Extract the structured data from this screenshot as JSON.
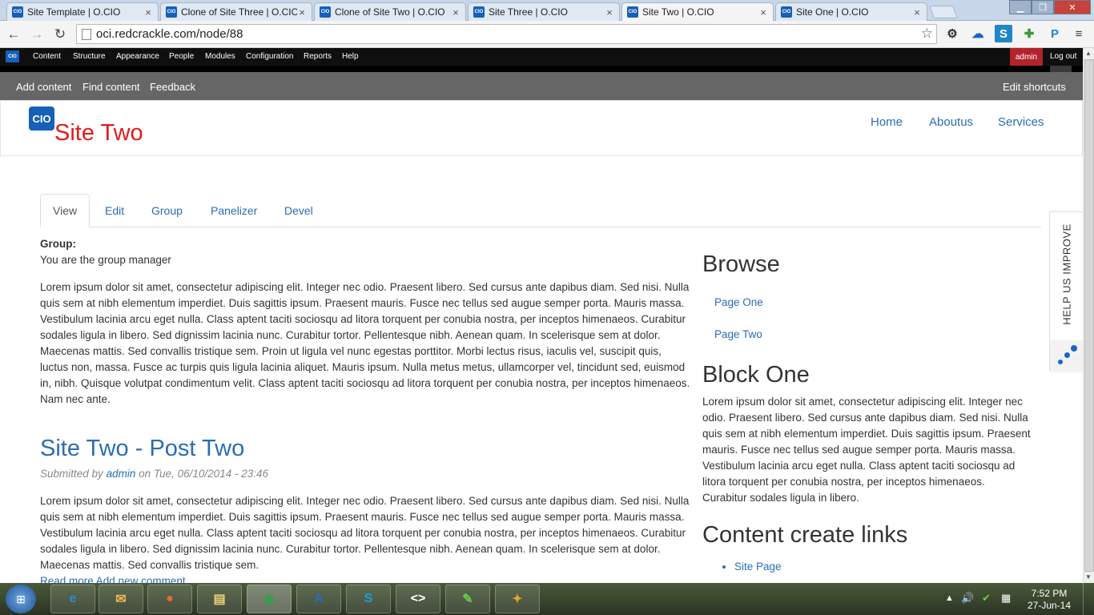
{
  "browser": {
    "tabs": [
      {
        "title": "Site Template | O.CIO",
        "favicon": "CIO"
      },
      {
        "title": "Clone of Site Three | O.CIO",
        "favicon": "CIO"
      },
      {
        "title": "Clone of Site Two | O.CIO",
        "favicon": "CIO"
      },
      {
        "title": "Site Three | O.CIO",
        "favicon": "CIO"
      },
      {
        "title": "Site Two | O.CIO",
        "favicon": "CIO",
        "active": true
      },
      {
        "title": "Site One | O.CIO",
        "favicon": "CIO"
      }
    ],
    "url": "oci.redcrackle.com/node/88"
  },
  "admin_menu": {
    "logo": "CIO",
    "items": [
      "Content",
      "Structure",
      "Appearance",
      "People",
      "Modules",
      "Configuration",
      "Reports",
      "Help"
    ],
    "user": "admin",
    "logout": "Log out"
  },
  "shortcuts": {
    "items": [
      "Add content",
      "Find content",
      "Feedback"
    ],
    "edit": "Edit shortcuts"
  },
  "site": {
    "logo": "CIO",
    "name": "Site Two",
    "nav": [
      "Home",
      "Aboutus",
      "Services"
    ]
  },
  "local_tabs": [
    "View",
    "Edit",
    "Group",
    "Panelizer",
    "Devel"
  ],
  "main": {
    "group_label": "Group:",
    "group_text": "You are the group manager",
    "body": "Lorem ipsum dolor sit amet, consectetur adipiscing elit. Integer nec odio. Praesent libero. Sed cursus ante dapibus diam. Sed nisi. Nulla quis sem at nibh elementum imperdiet. Duis sagittis ipsum. Praesent mauris. Fusce nec tellus sed augue semper porta. Mauris massa. Vestibulum lacinia arcu eget nulla. Class aptent taciti sociosqu ad litora torquent per conubia nostra, per inceptos himenaeos. Curabitur sodales ligula in libero. Sed dignissim lacinia nunc. Curabitur tortor. Pellentesque nibh. Aenean quam. In scelerisque sem at dolor. Maecenas mattis. Sed convallis tristique sem. Proin ut ligula vel nunc egestas porttitor. Morbi lectus risus, iaculis vel, suscipit quis, luctus non, massa. Fusce ac turpis quis ligula lacinia aliquet. Mauris ipsum. Nulla metus metus, ullamcorper vel, tincidunt sed, euismod in, nibh. Quisque volutpat condimentum velit. Class aptent taciti sociosqu ad litora torquent per conubia nostra, per inceptos himenaeos. Nam nec ante.",
    "post": {
      "title": "Site Two - Post Two",
      "submitted_prefix": "Submitted by",
      "author": "admin",
      "submitted_suffix": "on Tue, 06/10/2014 - 23:46",
      "body": "Lorem ipsum dolor sit amet, consectetur adipiscing elit. Integer nec odio. Praesent libero. Sed cursus ante dapibus diam. Sed nisi. Nulla quis sem at nibh elementum imperdiet. Duis sagittis ipsum. Praesent mauris. Fusce nec tellus sed augue semper porta. Mauris massa. Vestibulum lacinia arcu eget nulla. Class aptent taciti sociosqu ad litora torquent per conubia nostra, per inceptos himenaeos. Curabitur sodales ligula in libero. Sed dignissim lacinia nunc. Curabitur tortor. Pellentesque nibh. Aenean quam. In scelerisque sem at dolor. Maecenas mattis. Sed convallis tristique sem.",
      "links": "Read more   Add new comment"
    }
  },
  "sidebar": {
    "browse_title": "Browse",
    "browse_links": [
      "Page One",
      "Page Two"
    ],
    "block_one_title": "Block One",
    "block_one_text": "Lorem ipsum dolor sit amet, consectetur adipiscing elit. Integer nec odio. Praesent libero. Sed cursus ante dapibus diam. Sed nisi. Nulla quis sem at nibh elementum imperdiet. Duis sagittis ipsum. Praesent mauris. Fusce nec tellus sed augue semper porta. Mauris massa. Vestibulum lacinia arcu eget nulla. Class aptent taciti sociosqu ad litora torquent per conubia nostra, per inceptos himenaeos. Curabitur sodales ligula in libero.",
    "content_links_title": "Content create links",
    "content_links": [
      "Site Page"
    ]
  },
  "feedback_tab": "HELP US IMPROVE",
  "taskbar": {
    "time": "7:52 PM",
    "date": "27-Jun-14"
  },
  "colors": {
    "link": "#2a6db5",
    "site_name": "#e21b1b",
    "admin_user_bg": "#b3232c",
    "logo_blue": "#1660b8"
  }
}
